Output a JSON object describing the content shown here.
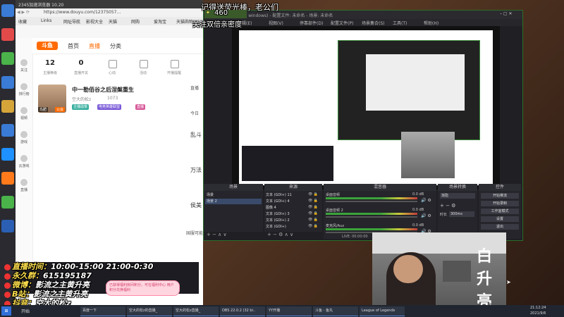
{
  "browser": {
    "window_title": "2345加速浏览器 10.20",
    "url": "https://www.douyu.com/12375057...",
    "bookmarks": [
      "收藏",
      "Links",
      "网址导航",
      "影视大全",
      "天猫",
      "网购",
      "爱淘宝",
      "天猫购物"
    ],
    "nav": [
      "首页",
      "直播",
      "分类"
    ],
    "stats": [
      {
        "num": "12",
        "label": "主播等级"
      },
      {
        "num": "0",
        "label": "直播开关"
      },
      {
        "num": "",
        "label": "心动"
      },
      {
        "num": "",
        "label": "活动"
      },
      {
        "num": "",
        "label": "开播提醒"
      }
    ],
    "sidebar": [
      "关注",
      "排行榜",
      "视频",
      "游戏",
      "云游戏",
      "直播"
    ],
    "card": {
      "title": "中一勒佰谷之后涅槃重生",
      "meta": "空大的松z",
      "count": "1073",
      "owner": "鸟肥",
      "owner_tag": "公会",
      "tags": [
        "主播勋章",
        "电竞英雄联盟",
        "直播"
      ]
    },
    "right_snips": [
      "直播",
      "今日",
      "乱斗",
      "万法",
      "侯美"
    ],
    "bottom_snip": "国服可能"
  },
  "obs": {
    "title": "OBS 22.0.2 (32-bit, windows) - 配置文件: 未命名 - 场景: 未命名",
    "menu": [
      "文件(F)",
      "编辑(E)",
      "视图(V)",
      "停靠部件(D)",
      "配置文件(P)",
      "场景集合(S)",
      "工具(T)",
      "帮助(H)"
    ],
    "panels": {
      "scenes": "场景",
      "sources": "来源",
      "mixer": "混音器",
      "transitions": "场景转换",
      "controls": "控件"
    },
    "scenes": [
      "场景",
      "场景 2"
    ],
    "sources": [
      "文本 (GDI+) 11",
      "文本 (GDI+) 4",
      "图像 4",
      "文本 (GDI+) 3",
      "文本 (GDI+) 2",
      "文本 (GDI+)"
    ],
    "mixer": [
      {
        "name": "桌面音频",
        "db": "0.0 dB"
      },
      {
        "name": "桌面音频 2",
        "db": "0.0 dB"
      },
      {
        "name": "麦克风/Aux",
        "db": "0.0 dB"
      }
    ],
    "transition": {
      "type": "渐隐",
      "duration_label": "时长",
      "duration": "300ms"
    },
    "controls": [
      "开始推流",
      "开始录制",
      "工作室模式",
      "设置",
      "退出"
    ],
    "status": "LIVE: 00:00:00"
  },
  "overlay_top": {
    "gift_line1": "记得送荧光棒，老公们",
    "gift_num": "460",
    "gift_line2": "关注双倍亲密度"
  },
  "overlays": [
    {
      "label": "直播时间：",
      "value": "10:00-15:00 21:00-0:30"
    },
    {
      "label": "永久群：",
      "value": "615195187"
    },
    {
      "label": "微博：",
      "value": "影流之主黄升亮"
    },
    {
      "label": "B站：",
      "value": "影流之主黄升亮"
    },
    {
      "label": "抖音：",
      "value": "空大的松z"
    }
  ],
  "chat_bubble": "已获得福利房间积分，可在福利中心 用户积分兑换福利",
  "cam": {
    "chars": [
      "白",
      "升",
      "亮"
    ]
  },
  "taskbar": {
    "start": "开始",
    "tasks": [
      "百度一下",
      "空大的松z的直播_",
      "空大的松z直播_",
      "OBS 22.0.2 (32 bi..",
      "YY开播",
      "斗鱼 - 鱼丸",
      "League of Legends"
    ],
    "time": "21:12:24",
    "date": "2021/9/6"
  },
  "colors": {
    "accent": "#ff6a00",
    "obs_border": "#2a6e2a",
    "overlay_label": "#ffe14d"
  }
}
